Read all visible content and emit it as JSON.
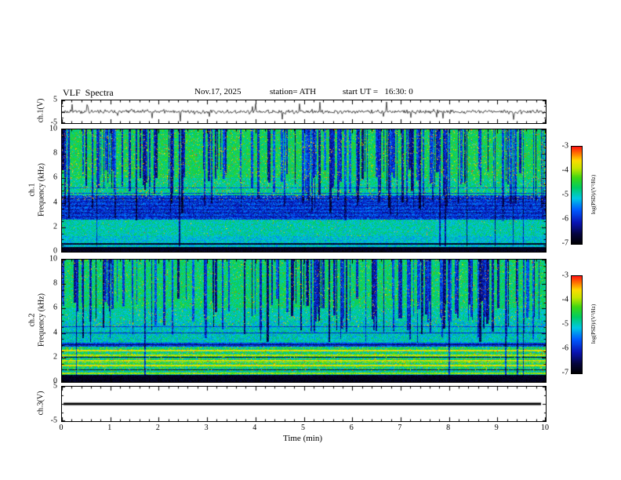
{
  "header": {
    "title": "VLF  Spectra",
    "date": "Nov.17, 2025",
    "station": "station= ATH",
    "start_ut": "start UT =   16:30: 0"
  },
  "chart_data": {
    "type": "heatmap",
    "title": "VLF Spectra",
    "date": "Nov.17, 2025",
    "station": "ATH",
    "start_ut": "16:30:0",
    "x": {
      "label": "Time  (min)",
      "range": [
        0,
        10
      ],
      "ticks": [
        0,
        1,
        2,
        3,
        4,
        5,
        6,
        7,
        8,
        9,
        10
      ],
      "minor_per_major": 5
    },
    "colormap": [
      [
        0,
        0,
        0,
        0
      ],
      [
        0.1,
        5,
        5,
        60
      ],
      [
        0.22,
        10,
        20,
        180
      ],
      [
        0.35,
        0,
        90,
        255
      ],
      [
        0.47,
        0,
        200,
        230
      ],
      [
        0.58,
        0,
        205,
        100
      ],
      [
        0.68,
        60,
        215,
        20
      ],
      [
        0.78,
        200,
        230,
        0
      ],
      [
        0.86,
        255,
        220,
        0
      ],
      [
        0.93,
        255,
        120,
        0
      ],
      [
        1,
        255,
        20,
        20
      ]
    ],
    "panels": [
      {
        "id": "ch1-waveform",
        "type": "line",
        "ylabel": "ch.1(V)",
        "ylim": [
          -5,
          5
        ],
        "yticks": [
          5,
          -5
        ],
        "description": "broadband noise around 0 V with impulsive spikes spanning the full panel",
        "render": {
          "seed": 11,
          "spike_p": 0.05
        }
      },
      {
        "id": "ch1-spectrogram",
        "type": "heatmap",
        "ylabel_line1": "ch.1",
        "ylabel_line2": "Frequency (kHz)",
        "ylim": [
          0,
          10
        ],
        "yticks": [
          10,
          8,
          6,
          4,
          2,
          0
        ],
        "colorbar": {
          "label": "log(PSD)/(V²/Hz)",
          "ticks": [
            -3,
            -4,
            -5,
            -6,
            -7
          ],
          "range": [
            -7,
            -3
          ]
        },
        "description": "green/cyan background with dense dark-blue vertical sferic streaks, dark band 2.6-4.6 kHz with thin dark interference lines, black band below 0.4 kHz, yellow/red speckles above ~4 kHz",
        "render": {
          "seed": 7,
          "bands": [
            [
              6,
              10.01,
              0.6,
              0.1
            ],
            [
              4.6,
              6,
              0.55,
              0.1
            ],
            [
              2.6,
              4.6,
              0.3,
              0.12
            ],
            [
              1.3,
              2.6,
              0.52,
              0.1
            ],
            [
              0.4,
              1.3,
              0.48,
              0.1
            ],
            [
              0,
              0.4,
              0.05,
              0.04
            ]
          ],
          "lines": [
            [
              4.35,
              0.18,
              1
            ],
            [
              4.05,
              0.2,
              1
            ],
            [
              3.75,
              0.18,
              1
            ],
            [
              3.45,
              0.2,
              1
            ],
            [
              3.15,
              0.18,
              1
            ],
            [
              2.85,
              0.2,
              1
            ],
            [
              5.2,
              0.35,
              1
            ],
            [
              4.8,
              0.3,
              1
            ],
            [
              0.62,
              0.06,
              2
            ]
          ],
          "streaks": {
            "count": 150,
            "fmin_lo": 2.5,
            "fmin_hi": 6.8,
            "depth_lo": 0.25,
            "depth_hi": 0.6,
            "full_count": 8
          },
          "speckle": {
            "fmin": 4.2,
            "p_yellow": 0.05,
            "p_red": 0.006
          },
          "speckle2": {
            "f0": 1.3,
            "f1": 2.6,
            "p": 0.006
          }
        }
      },
      {
        "id": "ch2-spectrogram",
        "type": "heatmap",
        "ylabel_line1": "ch.2",
        "ylabel_line2": "Frequency (kHz)",
        "ylim": [
          0,
          10
        ],
        "yticks": [
          10,
          8,
          6,
          4,
          2,
          0
        ],
        "colorbar": {
          "label": "log(PSD)/(V²/Hz)",
          "ticks": [
            -3,
            -4,
            -5,
            -6,
            -7
          ],
          "range": [
            -7,
            -3
          ]
        },
        "description": "green background with dark-blue vertical streaks above ~3 kHz, strong horizontal yellow/red power-line bands 0.7-2.8 kHz, black lines at ~0.5,1,2,3 kHz, black band below 0.45 kHz",
        "render": {
          "seed": 19,
          "bands": [
            [
              6,
              10.01,
              0.58,
              0.1
            ],
            [
              5,
              6,
              0.52,
              0.1
            ],
            [
              3.2,
              5,
              0.5,
              0.12
            ],
            [
              2.9,
              3.2,
              0.3,
              0.1
            ],
            [
              0.9,
              2.9,
              0.58,
              0.16
            ],
            [
              0.45,
              0.9,
              0.52,
              0.12
            ],
            [
              0,
              0.45,
              0.05,
              0.04
            ]
          ],
          "lines": [
            [
              1.02,
              0.1,
              1
            ],
            [
              2.02,
              0.1,
              1
            ],
            [
              3.05,
              0.12,
              1
            ],
            [
              0.5,
              0.07,
              2
            ],
            [
              4.0,
              0.25,
              1
            ],
            [
              4.5,
              0.3,
              1
            ],
            [
              2.55,
              0.82,
              2
            ],
            [
              2.2,
              0.78,
              2
            ],
            [
              1.75,
              0.8,
              2
            ],
            [
              1.35,
              0.82,
              2
            ],
            [
              0.7,
              0.75,
              2
            ],
            [
              1.55,
              0.72,
              1
            ]
          ],
          "streaks": {
            "count": 140,
            "fmin_lo": 3.2,
            "fmin_hi": 6.8,
            "depth_lo": 0.25,
            "depth_hi": 0.6,
            "full_count": 6
          },
          "speckle": {
            "fmin": 4.5,
            "p_yellow": 0.03,
            "p_red": 0.004
          },
          "speckle2": {
            "f0": 0.9,
            "f1": 2.9,
            "p": 0.03
          }
        }
      },
      {
        "id": "ch3-waveform",
        "type": "line",
        "ylabel": "ch.3(V)",
        "ylim": [
          -5,
          5
        ],
        "yticks": [
          5,
          -5
        ],
        "description": "constant flat signal at 0 V (thick black line)",
        "render": {
          "flat_value": 0
        }
      }
    ]
  }
}
